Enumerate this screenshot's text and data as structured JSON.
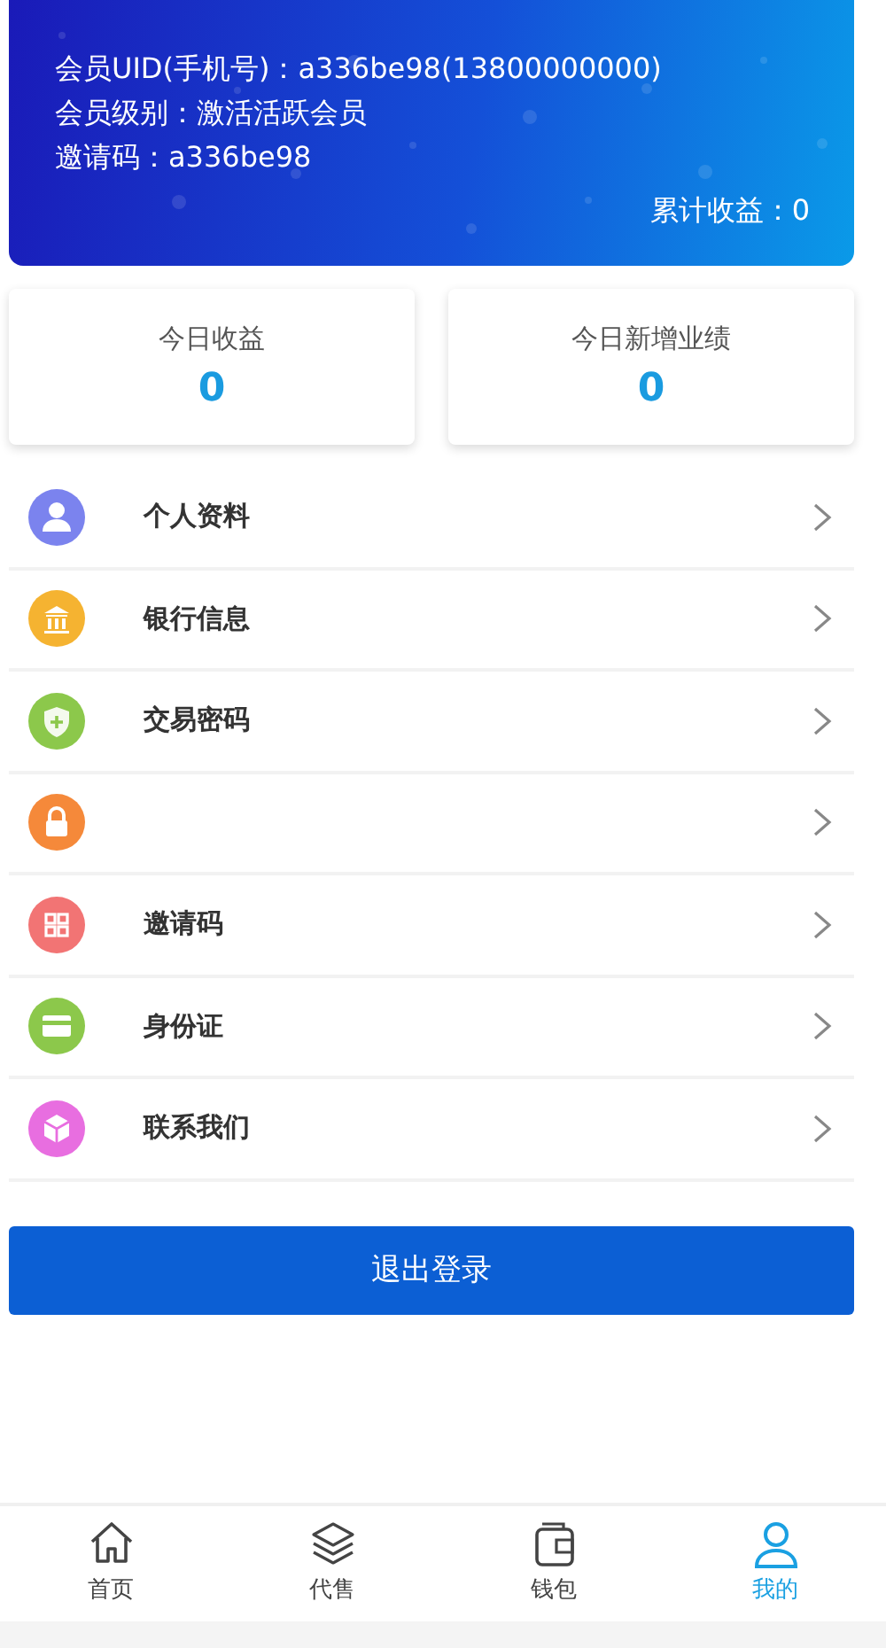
{
  "header": {
    "lines": [
      "会员UID(手机号)：a336be98(13800000000)",
      "会员级别：激活活跃会员",
      "邀请码：a336be98"
    ],
    "total": "累计收益：0"
  },
  "stats": [
    {
      "label": "今日收益",
      "value": "0"
    },
    {
      "label": "今日新增业绩",
      "value": "0"
    }
  ],
  "menu": [
    {
      "kind": "person",
      "color": "#7b83ee",
      "label": "个人资料"
    },
    {
      "kind": "bank",
      "color": "#f5b331",
      "label": "银行信息"
    },
    {
      "kind": "shield",
      "color": "#8cc84b",
      "label": "交易密码"
    },
    {
      "kind": "lock",
      "color": "#f5893a"
    },
    {
      "kind": "qr",
      "color": "#f27474",
      "label": "邀请码"
    },
    {
      "kind": "card",
      "color": "#8cc84b",
      "label": "身份证"
    },
    {
      "kind": "cube",
      "color": "#e86ee0",
      "label": "联系我们"
    }
  ],
  "logout": "退出登录",
  "nav": [
    {
      "kind": "home",
      "label": "首页",
      "selected": false
    },
    {
      "kind": "layers",
      "label": "代售",
      "selected": false
    },
    {
      "kind": "wallet",
      "label": "钱包",
      "selected": false
    },
    {
      "kind": "user",
      "label": "我的",
      "selected": true
    }
  ]
}
